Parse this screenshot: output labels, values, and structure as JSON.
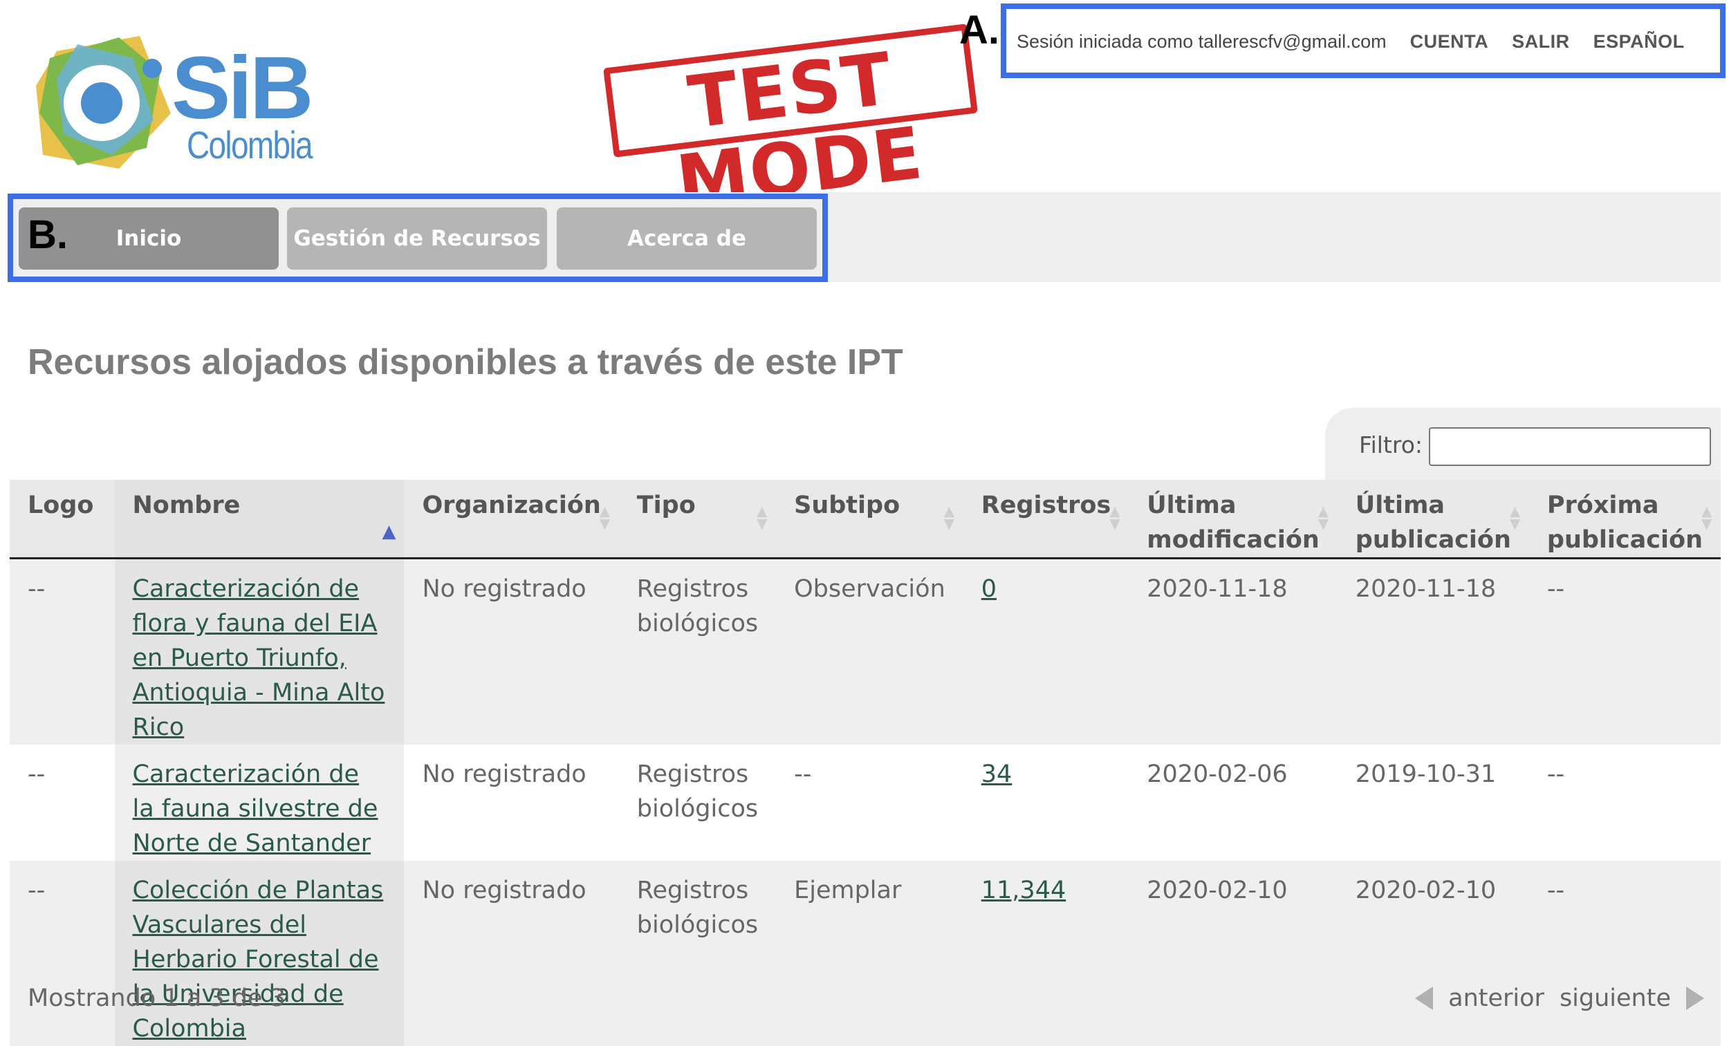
{
  "header": {
    "logo_text": "SiB",
    "logo_subtext": "Colombia",
    "stamp_text": "TEST MODE",
    "annotation_a": "A.",
    "annotation_b": "B."
  },
  "account_bar": {
    "session_text": "Sesión iniciada como tallerescfv@gmail.com",
    "account_link": "CUENTA",
    "logout_link": "SALIR",
    "language_link": "ESPAÑOL"
  },
  "nav": {
    "items": [
      {
        "label": "Inicio",
        "active": true
      },
      {
        "label": "Gestión de Recursos",
        "active": false
      },
      {
        "label": "Acerca de",
        "active": false
      }
    ]
  },
  "main": {
    "title": "Recursos alojados disponibles a través de este IPT",
    "filter_label": "Filtro:",
    "filter_value": ""
  },
  "table": {
    "columns": [
      "Logo",
      "Nombre",
      "Organización",
      "Tipo",
      "Subtipo",
      "Registros",
      "Última modificación",
      "Última publicación",
      "Próxima publicación"
    ],
    "rows": [
      {
        "logo": "--",
        "nombre": "Caracterización de flora y fauna del EIA en Puerto Triunfo, Antioquia - Mina Alto Rico",
        "organizacion": "No registrado",
        "tipo": "Registros biológicos",
        "subtipo": "Observación",
        "registros": "0",
        "ultima_modificacion": "2020-11-18",
        "ultima_publicacion": "2020-11-18",
        "proxima_publicacion": "--"
      },
      {
        "logo": "--",
        "nombre": "Caracterización de la fauna silvestre de Norte de Santander",
        "organizacion": "No registrado",
        "tipo": "Registros biológicos",
        "subtipo": "--",
        "registros": "34",
        "ultima_modificacion": "2020-02-06",
        "ultima_publicacion": "2019-10-31",
        "proxima_publicacion": "--"
      },
      {
        "logo": "--",
        "nombre": "Colección de Plantas Vasculares del Herbario Forestal de la Universidad de Colombia",
        "organizacion": "No registrado",
        "tipo": "Registros biológicos",
        "subtipo": "Ejemplar",
        "registros": "11,344",
        "ultima_modificacion": "2020-02-10",
        "ultima_publicacion": "2020-02-10",
        "proxima_publicacion": "--"
      }
    ]
  },
  "footer": {
    "showing_text": "Mostrando 1 a 3 de 3",
    "prev_label": "anterior",
    "next_label": "siguiente"
  },
  "colors": {
    "highlight": "#3c6ee6",
    "stamp": "#d22a2a",
    "logo_blue": "#4a8ed0",
    "link": "#2c5a4a"
  }
}
